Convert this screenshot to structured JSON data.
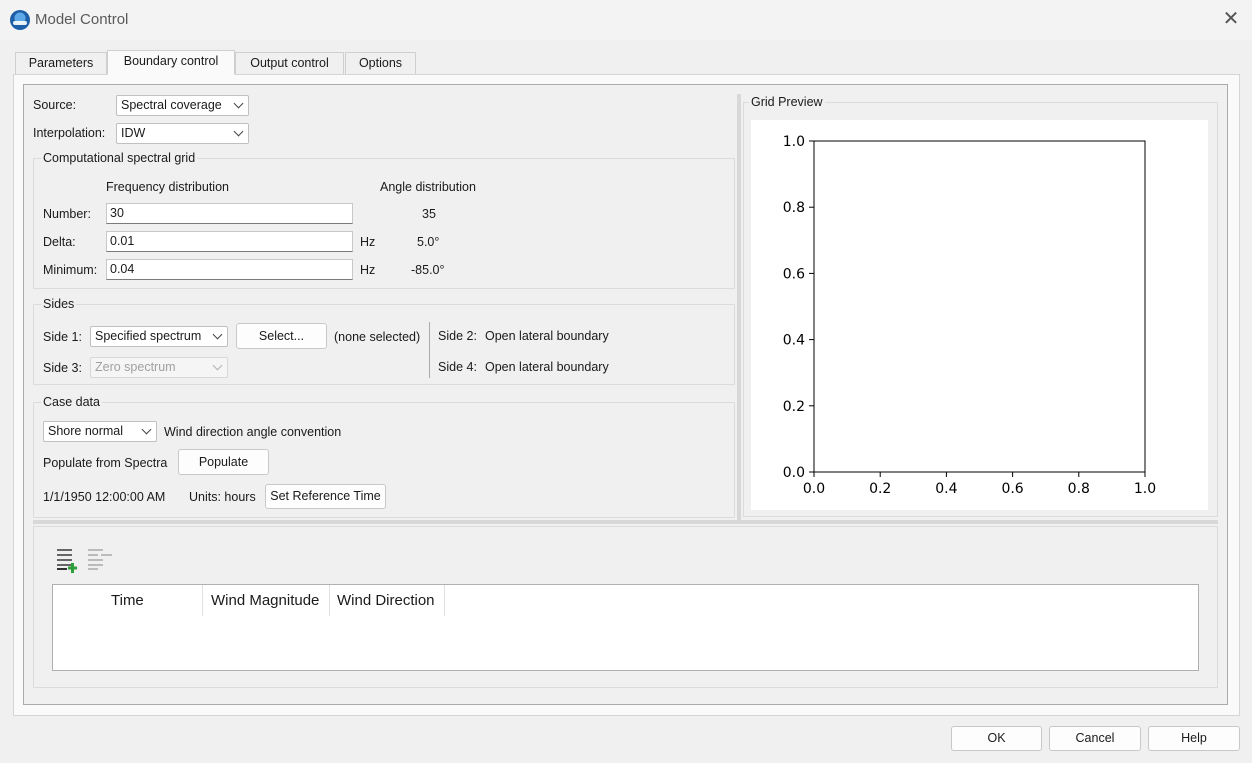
{
  "window": {
    "title": "Model Control",
    "close_icon": "close-icon"
  },
  "tabs": [
    {
      "label": "Parameters",
      "active": false
    },
    {
      "label": "Boundary control",
      "active": true
    },
    {
      "label": "Output control",
      "active": false
    },
    {
      "label": "Options",
      "active": false
    }
  ],
  "source": {
    "label": "Source:",
    "value": "Spectral coverage"
  },
  "interpolation": {
    "label": "Interpolation:",
    "value": "IDW"
  },
  "spectral_grid": {
    "title": "Computational spectral grid",
    "freq_header": "Frequency distribution",
    "angle_header": "Angle distribution",
    "rows": [
      {
        "label": "Number:",
        "freq": "30",
        "unit": "",
        "angle": "35"
      },
      {
        "label": "Delta:",
        "freq": "0.01",
        "unit": "Hz",
        "angle": "5.0°"
      },
      {
        "label": "Minimum:",
        "freq": "0.04",
        "unit": "Hz",
        "angle": "-85.0°"
      }
    ]
  },
  "sides": {
    "title": "Sides",
    "side1_label": "Side 1:",
    "side1_value": "Specified spectrum",
    "select_button": "Select...",
    "selection_status": "(none selected)",
    "side3_label": "Side 3:",
    "side3_value": "Zero spectrum",
    "side2_label": "Side 2:",
    "side2_value": "Open lateral boundary",
    "side4_label": "Side 4:",
    "side4_value": "Open lateral boundary"
  },
  "case_data": {
    "title": "Case data",
    "convention_value": "Shore normal",
    "convention_label": "Wind direction angle convention",
    "populate_label": "Populate from Spectra",
    "populate_button": "Populate",
    "reference_time": "1/1/1950 12:00:00 AM",
    "units": "Units: hours",
    "set_ref_button": "Set Reference Time"
  },
  "grid_preview": {
    "title": "Grid Preview",
    "x_ticks": [
      "0.0",
      "0.2",
      "0.4",
      "0.6",
      "0.8",
      "1.0"
    ],
    "y_ticks": [
      "0.0",
      "0.2",
      "0.4",
      "0.6",
      "0.8",
      "1.0"
    ]
  },
  "table": {
    "toolbar": {
      "add_row_icon": "add-row-icon",
      "remove_row_icon": "remove-row-icon"
    },
    "columns": [
      "Time",
      "Wind Magnitude",
      "Wind Direction"
    ],
    "rows": []
  },
  "buttons": {
    "ok": "OK",
    "cancel": "Cancel",
    "help": "Help"
  }
}
